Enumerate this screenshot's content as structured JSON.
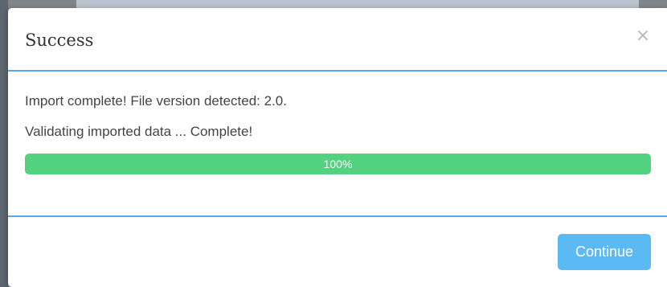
{
  "modal": {
    "title": "Success",
    "close_symbol": "×",
    "close_icon": "close-icon",
    "messages": [
      "Import complete! File version detected: 2.0.",
      "Validating imported data ... Complete!"
    ],
    "progress": {
      "percent": 100,
      "label": "100%"
    },
    "continue_label": "Continue"
  },
  "colors": {
    "accent": "#58a8e8",
    "progress_fill": "#52d27f",
    "button": "#5bb9f4"
  }
}
